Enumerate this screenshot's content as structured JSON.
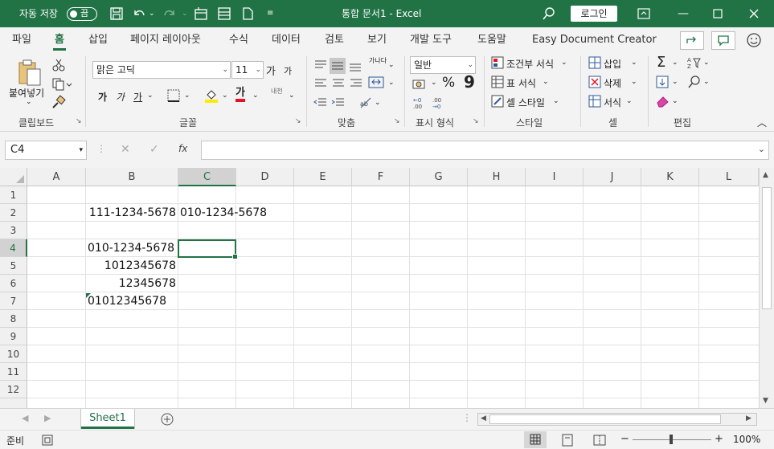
{
  "titlebar": {
    "autosave_label": "자동 저장",
    "autosave_state": "끔",
    "doc_title": "통합 문서1  -  Excel",
    "login_label": "로그인"
  },
  "tabs": [
    "파일",
    "홈",
    "삽입",
    "페이지 레이아웃",
    "수식",
    "데이터",
    "검토",
    "보기",
    "개발 도구",
    "도움말",
    "Easy Document Creator"
  ],
  "ribbon": {
    "clipboard": {
      "paste_label": "붙여넣기",
      "group": "클립보드"
    },
    "font": {
      "font_name": "맑은 고딕",
      "font_size": "11",
      "group": "글꼴",
      "bold": "가",
      "italic": "가",
      "underline": "가",
      "grow": "가",
      "shrink": "가",
      "font_color": "가",
      "phonetic": "내천"
    },
    "align": {
      "group": "맞춤",
      "wrap": "가나다"
    },
    "number": {
      "format": "일반",
      "group": "표시 형식",
      "percent": "%",
      "comma": "9"
    },
    "styles": {
      "conditional": "조건부 서식",
      "table": "표 서식",
      "cell_style": "셀 스타일",
      "group": "스타일"
    },
    "cells": {
      "insert": "삽입",
      "delete": "삭제",
      "format": "서식",
      "group": "셀"
    },
    "editing": {
      "group": "편집"
    }
  },
  "formula_bar": {
    "name_box": "C4",
    "formula": "",
    "fx": "fx"
  },
  "grid": {
    "columns": [
      "A",
      "B",
      "C",
      "D",
      "E",
      "F",
      "G",
      "H",
      "I",
      "J",
      "K",
      "L"
    ],
    "rows": [
      "1",
      "2",
      "3",
      "4",
      "5",
      "6",
      "7",
      "8",
      "9",
      "10",
      "11",
      "12"
    ],
    "cells": {
      "B2": "111-1234-5678",
      "C2": "010-1234-5678",
      "B4": "010-1234-5678",
      "B5": "1012345678",
      "B6": "12345678",
      "B7": "01012345678"
    }
  },
  "sheets": {
    "sheet1": "Sheet1"
  },
  "status": {
    "ready": "준비",
    "zoom": "100%"
  },
  "colors": {
    "accent": "#217346"
  }
}
